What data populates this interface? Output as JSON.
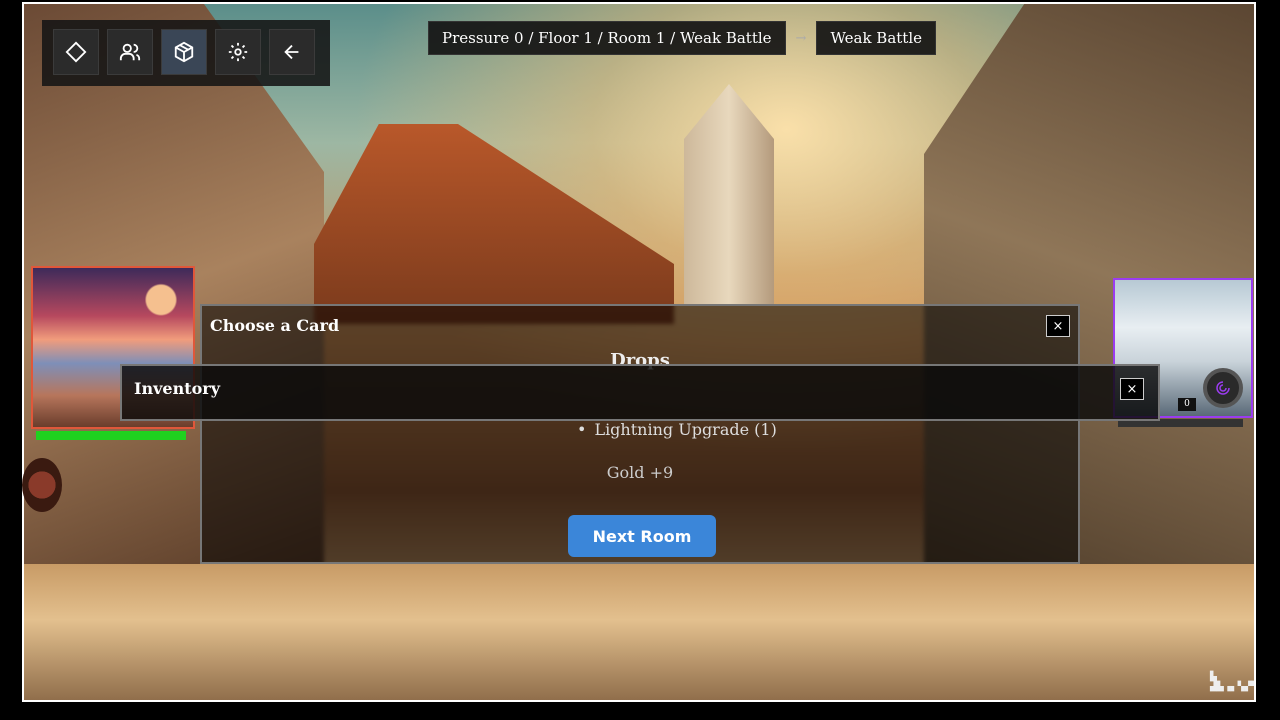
{
  "toolbar": {
    "buttons": [
      {
        "name": "map-button",
        "icon": "diamond-icon"
      },
      {
        "name": "party-button",
        "icon": "users-icon"
      },
      {
        "name": "inventory-button",
        "icon": "cube-icon",
        "active": true
      },
      {
        "name": "settings-button",
        "icon": "gear-icon"
      },
      {
        "name": "back-button",
        "icon": "arrow-left-icon"
      }
    ]
  },
  "breadcrumb": {
    "location": "Pressure 0 / Floor 1 / Room 1 / Weak Battle",
    "separator": "→",
    "current": "Weak Battle"
  },
  "player": {
    "hp_fraction": 1.0,
    "hp_color": "#1fd11f",
    "frame_color": "#e0573a"
  },
  "foe": {
    "frame_color": "#9b3cf0",
    "count": "0"
  },
  "choose_card": {
    "title": "Choose a Card",
    "close": "×",
    "drops_heading": "Drops",
    "drops": [
      "Lightning Upgrade (1)"
    ],
    "gold": "Gold +9",
    "next_button": "Next Room",
    "accent": "#3b86d9"
  },
  "inventory": {
    "title": "Inventory",
    "close": "×"
  }
}
